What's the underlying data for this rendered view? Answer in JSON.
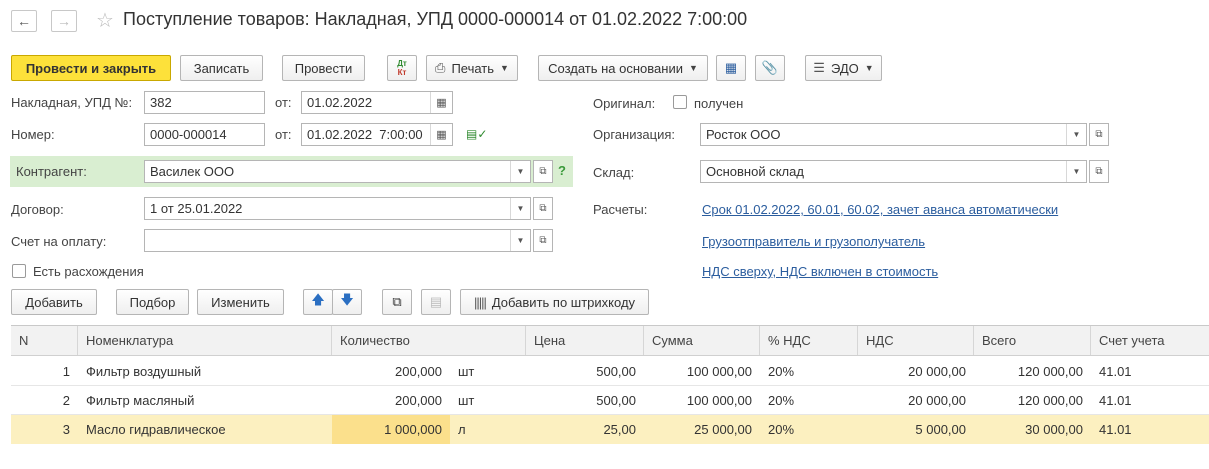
{
  "window": {
    "title": "Поступление товаров: Накладная, УПД 0000-000014 от 01.02.2022 7:00:00"
  },
  "toolbar": {
    "post_close": "Провести и закрыть",
    "save": "Записать",
    "post": "Провести",
    "dtkt_top": "Дт",
    "dtkt_bottom": "Кт",
    "print": "Печать",
    "create_based": "Создать на основании",
    "edo": "ЭДО"
  },
  "form": {
    "invoice_label": "Накладная, УПД №:",
    "invoice_number": "382",
    "from_label": "от:",
    "invoice_date": "01.02.2022",
    "number_label": "Номер:",
    "number": "0000-000014",
    "from_label2": "от:",
    "date_time": "01.02.2022  7:00:00",
    "counterparty_label": "Контрагент:",
    "counterparty": "Василек ООО",
    "help": "?",
    "contract_label": "Договор:",
    "contract": "1 от 25.01.2022",
    "payment_label": "Счет на оплату:",
    "payment": "",
    "discrepancy_label": "Есть расхождения",
    "original_label": "Оригинал:",
    "original_received": "получен",
    "organization_label": "Организация:",
    "organization": "Росток ООО",
    "warehouse_label": "Склад:",
    "warehouse": "Основной склад",
    "settlements_label": "Расчеты:",
    "settlements_link": "Срок 01.02.2022, 60.01, 60.02, зачет аванса автоматически",
    "shipper_link": "Грузоотправитель и грузополучатель",
    "vat_link": "НДС сверху, НДС включен в стоимость"
  },
  "table_toolbar": {
    "add": "Добавить",
    "select": "Подбор",
    "edit": "Изменить",
    "barcode": "Добавить по штрихкоду"
  },
  "table": {
    "headers": [
      "N",
      "Номенклатура",
      "Количество",
      "Цена",
      "Сумма",
      "% НДС",
      "НДС",
      "Всего",
      "Счет учета"
    ],
    "rows": [
      {
        "n": "1",
        "name": "Фильтр воздушный",
        "qty": "200,000",
        "unit": "шт",
        "price": "500,00",
        "sum": "100 000,00",
        "vat_rate": "20%",
        "vat": "20 000,00",
        "total": "120 000,00",
        "account": "41.01"
      },
      {
        "n": "2",
        "name": "Фильтр масляный",
        "qty": "200,000",
        "unit": "шт",
        "price": "500,00",
        "sum": "100 000,00",
        "vat_rate": "20%",
        "vat": "20 000,00",
        "total": "120 000,00",
        "account": "41.01"
      },
      {
        "n": "3",
        "name": "Масло гидравлическое",
        "qty": "1 000,000",
        "unit": "л",
        "price": "25,00",
        "sum": "25 000,00",
        "vat_rate": "20%",
        "vat": "5 000,00",
        "total": "30 000,00",
        "account": "41.01"
      }
    ]
  },
  "colors": {
    "primary_button": "#fde13a",
    "highlight_green": "#d9eed1",
    "selected_row": "#fcf0c0",
    "link": "#2b5d9e"
  },
  "icons": [
    "back-arrow-icon",
    "forward-arrow-icon",
    "star-icon",
    "dt-kt-icon",
    "printer-icon",
    "structure-icon",
    "paperclip-icon",
    "edo-icon",
    "calendar-icon",
    "open-icon",
    "dropdown-icon",
    "up-arrow-icon",
    "down-arrow-icon",
    "copy-icon",
    "paste-icon",
    "barcode-icon",
    "checkmark-icon"
  ]
}
